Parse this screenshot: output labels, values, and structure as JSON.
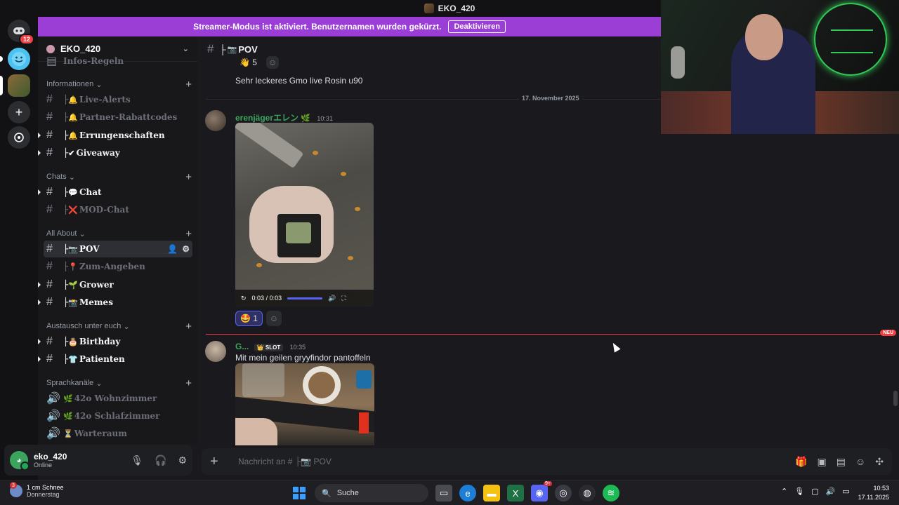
{
  "window": {
    "title": "EKO_420"
  },
  "rail": {
    "dm_badge": "12"
  },
  "banner": {
    "text": "Streamer-Modus ist aktiviert. Benutzernamen wurden gekürzt.",
    "button": "Deaktivieren"
  },
  "server": {
    "name": "EKO_420"
  },
  "sidebar": {
    "cut_channel": "Infos-Regeln",
    "categories": [
      {
        "label": "Informationen",
        "channels": [
          {
            "emoji": "🔔",
            "label": "Live-Alerts"
          },
          {
            "emoji": "🔔",
            "label": "Partner-Rabattcodes"
          },
          {
            "emoji": "🔔",
            "label": "Errungenschaften"
          },
          {
            "emoji": "✔",
            "label": "Giveaway"
          }
        ]
      },
      {
        "label": "Chats",
        "channels": [
          {
            "emoji": "💬",
            "label": "Chat"
          },
          {
            "emoji": "❌",
            "label": "MOD-Chat"
          }
        ]
      },
      {
        "label": "All About",
        "channels": [
          {
            "emoji": "📷",
            "label": "POV"
          },
          {
            "emoji": "📍",
            "label": "Zum-Angeben"
          },
          {
            "emoji": "🌱",
            "label": "Grower"
          },
          {
            "emoji": "📸",
            "label": "Memes"
          }
        ]
      },
      {
        "label": "Austausch unter euch",
        "channels": [
          {
            "emoji": "🎂",
            "label": "Birthday"
          },
          {
            "emoji": "👕",
            "label": "Patienten"
          }
        ]
      },
      {
        "label": "Sprachkanäle",
        "channels": [
          {
            "emoji": "🌿",
            "label": "42o Wohnzimmer"
          },
          {
            "emoji": "🌿",
            "label": "42o Schlafzimmer"
          },
          {
            "emoji": "⏳",
            "label": "Warteraum"
          }
        ]
      }
    ]
  },
  "user": {
    "name": "eko_420",
    "status": "Online"
  },
  "channel": {
    "prefix": "├",
    "emoji": "📷",
    "name": "POV"
  },
  "messages": {
    "prev_reaction_count": "5",
    "prev_text": "Sehr leckeres Gmo live Rosin u90",
    "date_divider": "17. November 2025",
    "msg1": {
      "author": "erenjägerエレン",
      "time": "10:31",
      "video_time": "0:03 / 0:03",
      "reaction_emoji": "🤩",
      "reaction_count": "1"
    },
    "new_label": "NEU",
    "msg2": {
      "author": "G...",
      "tag": "SLOT",
      "time": "10:35",
      "text": "Mit mein geilen gryyfindor pantoffeln"
    }
  },
  "composer": {
    "placeholder": "Nachricht an # ├📷 POV"
  },
  "taskbar": {
    "weather_badge": "3",
    "weather_title": "1 cm Schnee",
    "weather_day": "Donnerstag",
    "search": "Suche",
    "time": "10:53",
    "date": "17.11.2025",
    "discord_badge": "9+"
  }
}
